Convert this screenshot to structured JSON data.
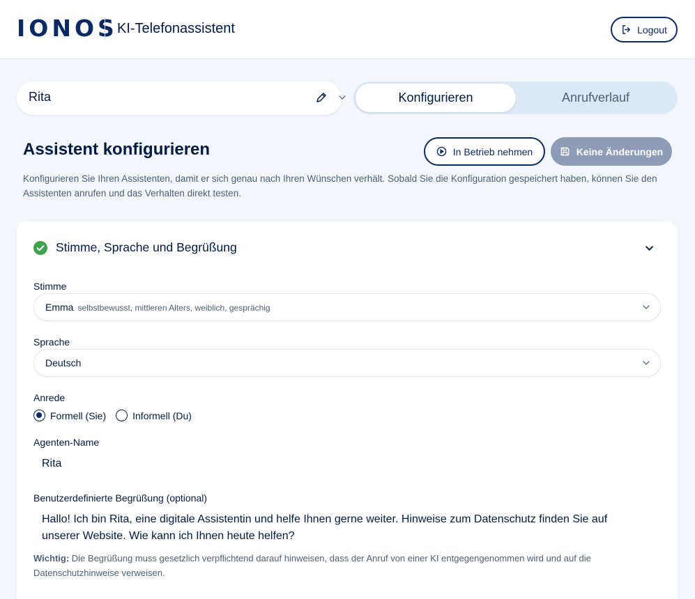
{
  "header": {
    "logo": "IONOS",
    "app_title": "KI-Telefonassistent",
    "logout_label": "Logout"
  },
  "assistant_selector": {
    "name": "Rita"
  },
  "tabs": [
    {
      "label": "Konfigurieren",
      "active": true
    },
    {
      "label": "Anrufverlauf",
      "active": false
    }
  ],
  "page": {
    "title": "Assistent konfigurieren",
    "run_button": "In Betrieb nehmen",
    "save_button": "Keine Änderungen",
    "intro": "Konfigurieren Sie Ihren Assistenten, damit er sich genau nach Ihren Wünschen verhält. Sobald Sie die Konfiguration gespeichert haben, können Sie den Assistenten anrufen und das Verhalten direkt testen."
  },
  "section": {
    "title": "Stimme, Sprache und Begrüßung",
    "status": "complete",
    "voice": {
      "label": "Stimme",
      "value": "Emma",
      "description": "selbstbewusst, mittleren Alters, weiblich, gesprächig"
    },
    "language": {
      "label": "Sprache",
      "value": "Deutsch"
    },
    "salutation": {
      "label": "Anrede",
      "options": [
        {
          "label": "Formell (Sie)",
          "selected": true
        },
        {
          "label": "Informell (Du)",
          "selected": false
        }
      ]
    },
    "agent_name": {
      "label": "Agenten-Name",
      "value": "Rita"
    },
    "greeting": {
      "label": "Benutzerdefinierte Begrüßung (optional)",
      "value": "Hallo! Ich bin Rita, eine digitale Assistentin und helfe Ihnen gerne weiter. Hinweise zum Datenschutz finden Sie auf unserer Website. Wie kann ich Ihnen heute helfen?"
    },
    "note": {
      "prefix": "Wichtig:",
      "text": "Die Begrüßung muss gesetzlich verpflichtend darauf hinweisen, dass der Anruf von einer KI entgegengenommen wird und auf die Datenschutzhinweise verweisen."
    }
  },
  "colors": {
    "brand": "#0b2a63",
    "background": "#f3f6fb",
    "success": "#3fa34d",
    "disabled_button": "#8f9cb8"
  }
}
